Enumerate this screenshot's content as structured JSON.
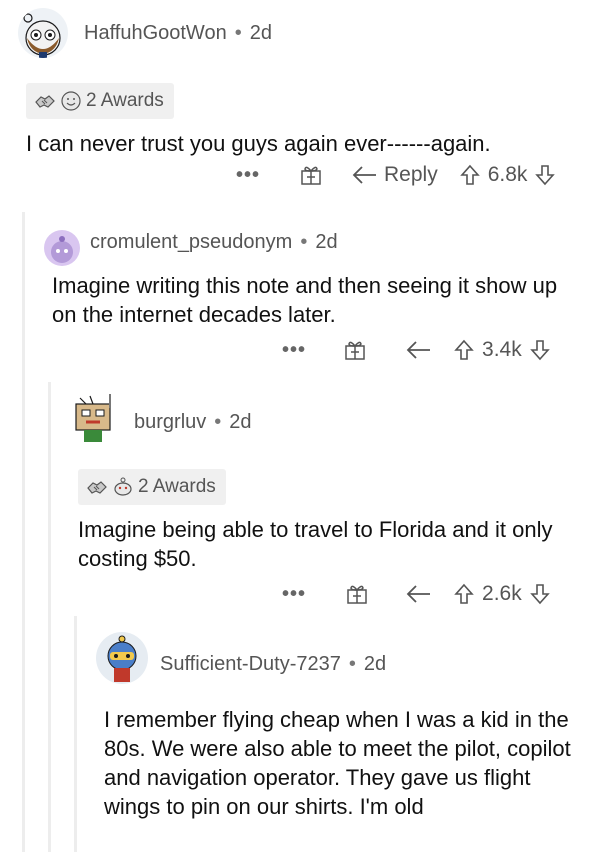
{
  "comments": [
    {
      "username": "HaffuhGootWon",
      "age": "2d",
      "awards_label": "2 Awards",
      "text": "I can never trust you guys again ever------again.",
      "reply_label": "Reply",
      "score": "6.8k"
    },
    {
      "username": "cromulent_pseudonym",
      "age": "2d",
      "text": "Imagine writing this note and then seeing it show up on the internet decades later.",
      "score": "3.4k"
    },
    {
      "username": "burgrluv",
      "age": "2d",
      "awards_label": "2 Awards",
      "text": "Imagine being able to travel to Florida and it only costing $50.",
      "score": "2.6k"
    },
    {
      "username": "Sufficient-Duty-7237",
      "age": "2d",
      "text": "I remember flying cheap when I was a kid in the 80s. We were also able to meet the pilot, copilot and navigation operator. They gave us flight wings to pin on our shirts. I'm old"
    }
  ],
  "icons": {
    "more": "more-options-icon",
    "gift": "gift-award-icon",
    "reply": "reply-arrow-icon",
    "upvote": "upvote-arrow-icon",
    "downvote": "downvote-arrow-icon"
  },
  "colors": {
    "text": "#111111",
    "meta": "#555555",
    "award_bg": "#f0f0f0",
    "thread_line": "#ededed"
  },
  "more_glyph": "•••",
  "separator": "•"
}
